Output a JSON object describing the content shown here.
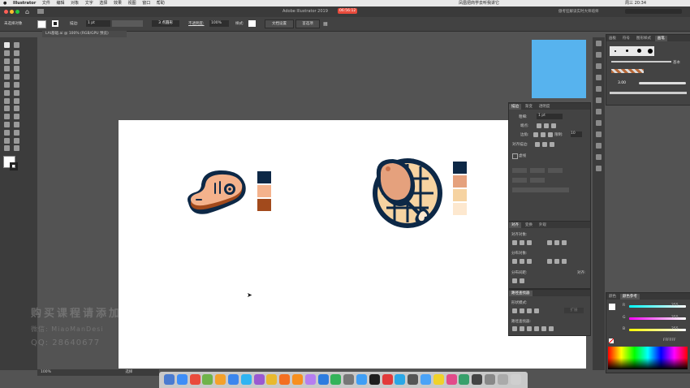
{
  "menubar": {
    "apple_icon": "apple-icon",
    "app_name": "Illustrator",
    "items": [
      "文件",
      "编辑",
      "对象",
      "文字",
      "选择",
      "效果",
      "视图",
      "窗口",
      "帮助"
    ],
    "right_text": "凤凰把商学去听我讲它",
    "clock": "周三 20:34"
  },
  "titlebar": {
    "title": "Adobe Illustrator 2019",
    "badge": "06:56:12",
    "right_text": "傲考狂解读实时大师培师"
  },
  "controlbar": {
    "selection_label": "未选择对象",
    "stroke_label": "描边:",
    "stroke_value": "1 pt",
    "brush_label": "3 点圆形",
    "opacity_label": "不透明度:",
    "opacity_value": "100%",
    "style_label": "样式:",
    "doc_setup": "文档设置",
    "prefs": "首选项"
  },
  "doctab": {
    "label": "LAI基础.ai @ 100% (RGB/GPU 预览)"
  },
  "statusbar": {
    "zoom": "100%",
    "tool": "选择"
  },
  "swatches": {
    "steak": [
      "#0d2846",
      "#f4b28c",
      "#a24a1c"
    ],
    "chicken": [
      "#0d2846",
      "#e5a17d",
      "#f6d3a1",
      "#fde8cf"
    ]
  },
  "brush_panel": {
    "tabs": [
      "画板",
      "符号",
      "图形样式",
      "画笔"
    ],
    "basic_label": "基本",
    "size_label": "3.00"
  },
  "stroke_panel": {
    "tabs": [
      "描边",
      "渐变",
      "透明度"
    ],
    "weight_label": "粗细:",
    "weight_value": "1 pt",
    "cap_label": "端点:",
    "corner_label": "边角:",
    "limit_label": "限制:",
    "limit_value": "10",
    "align_label": "对齐描边:",
    "dash_label": "虚线"
  },
  "align_panel": {
    "tabs": [
      "对齐",
      "变换",
      "外观"
    ],
    "align_objects": "对齐对象:",
    "distribute_objects": "分布对象:",
    "distribute_spacing": "分布间距:",
    "align_to": "对齐:"
  },
  "pathfinder_panel": {
    "tabs": [
      "路径查找器"
    ],
    "shape_modes": "形状模式:",
    "pathfinders": "路径查找器:",
    "expand_button": "扩展"
  },
  "color_panel": {
    "tabs": [
      "颜色",
      "颜色参考"
    ],
    "r_label": "R",
    "g_label": "G",
    "b_label": "B",
    "r_value": "255",
    "g_value": "255",
    "b_value": "255",
    "hex_value": "FFFFFF"
  },
  "watermark": {
    "line1": "购买课程请添加",
    "line2": "微信: MiaoManDesi",
    "line3": "QQ: 28640677"
  }
}
